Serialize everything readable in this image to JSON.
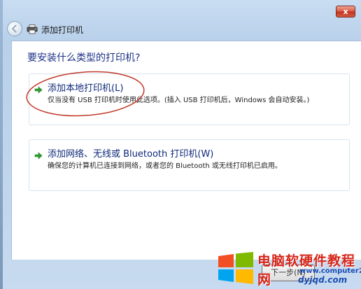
{
  "window": {
    "title": "添加打印机",
    "close_label": "x"
  },
  "main": {
    "question": "要安装什么类型的打印机?"
  },
  "options": [
    {
      "title": "添加本地打印机(L)",
      "description": "仅当没有 USB 打印机时使用此选项。(插入 USB 打印机后，Windows 会自动安装。)"
    },
    {
      "title": "添加网络、无线或 Bluetooth 打印机(W)",
      "description": "确保您的计算机已连接到网络，或者您的 Bluetooth 或无线打印机已启用。"
    }
  ],
  "footer": {
    "next_label": "下一步(N)"
  },
  "watermark": {
    "title": "电脑软硬件教程网",
    "url_main": "www.computer26.com",
    "url_alt": "dyjqd.com"
  },
  "colors": {
    "link_blue": "#0f2a7a",
    "arrow_green": "#2e9e2e",
    "annotation_red": "#c0392b"
  },
  "icons": {
    "back": "back-arrow-icon",
    "printer": "printer-icon",
    "option_arrow": "green-arrow-icon"
  }
}
